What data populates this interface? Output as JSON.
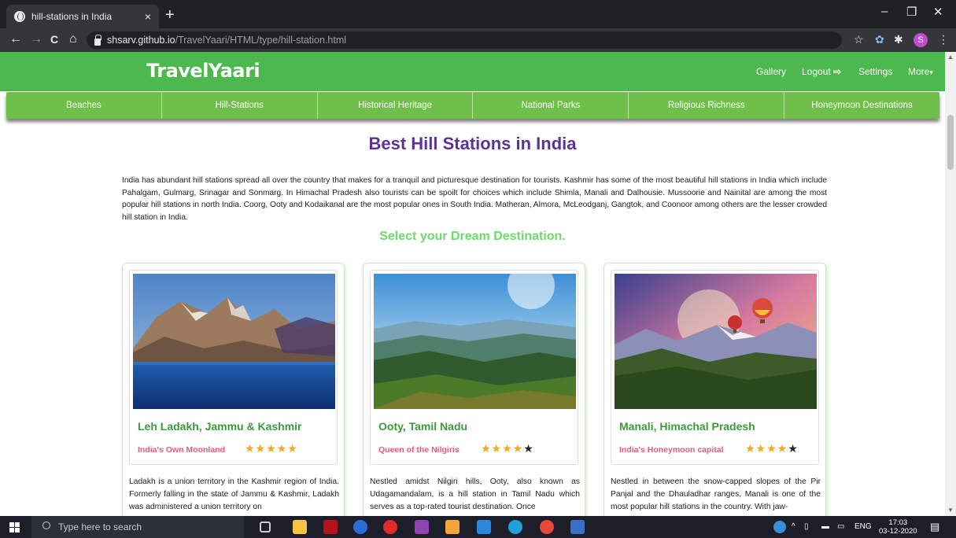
{
  "browser": {
    "tab_title": "hill-stations in India",
    "tab_close": "×",
    "new_tab": "+",
    "url_host": "shsarv.github.io",
    "url_path": "/TravelYaari/HTML/type/hill-station.html",
    "profile_initial": "S",
    "window_controls": {
      "minimize": "–",
      "restore": "❐",
      "close": "✕"
    },
    "nav": {
      "back": "←",
      "forward": "→",
      "reload": "C",
      "home": "⌂"
    },
    "extensions": {
      "star": "☆",
      "puzzle": "✱",
      "menu": "⋮",
      "ext1": "✿"
    }
  },
  "site": {
    "brand": "TravelYaari",
    "nav": {
      "gallery": "Gallery",
      "logout": "Logout",
      "logout_icon": "⇨",
      "settings": "Settings",
      "more": "More",
      "more_caret": "▾"
    },
    "categories": [
      "Beaches",
      "Hill-Stations",
      "Historical Heritage",
      "National Parks",
      "Religious Richness",
      "Honeymoon Destinations"
    ],
    "heading": "Best Hill Stations in India",
    "intro": "India has abundant hill stations spread all over the country that makes for a tranquil and picturesque destination for tourists. Kashmir has some of the most beautiful hill stations in India which include Pahalgam, Gulmarg, Srinagar and Sonmarg. In Himachal Pradesh also tourists can be spoilt for choices which include Shimla, Manali and Dalhousie. Mussoorie and Nainital are among the most popular hill stations in north India. Coorg, Ooty and Kodaikanal are the most popular ones in South India. Matheran, Almora, McLeodganj, Gangtok, and Coonoor among others are the lesser crowded hill station in India.",
    "subheading": "Select your Dream Destination.",
    "cards": [
      {
        "place": "Leh Ladakh, Jammu & Kashmir",
        "tagline": "India's Own Moonland",
        "rating": 5,
        "stars": "★★★★★",
        "stars_off": "",
        "description": "Ladakh is a union territory in the Kashmir region of India. Formerly falling in the state of Jammu & Kashmir, Ladakh was administered a union territory on"
      },
      {
        "place": "Ooty, Tamil Nadu",
        "tagline": "Queen of the Nilgiris",
        "rating": 4,
        "stars": "★★★★",
        "stars_off": "★",
        "description": "Nestled amidst Nilgiri hills, Ooty, also known as Udagamandalam, is a hill station in Tamil Nadu which serves as a top-rated tourist destination. Once"
      },
      {
        "place": "Manali, Himachal Pradesh",
        "tagline": "India's Honeymoon capital",
        "rating": 4,
        "stars": "★★★★",
        "stars_off": "★",
        "description": "Nestled in between the snow-capped slopes of the Pir Panjal and the Dhauladhar ranges, Manali is one of the most popular hill stations in the country. With jaw-"
      }
    ]
  },
  "taskbar": {
    "search_placeholder": "Type here to search",
    "tray_arrow": "^",
    "language": "ENG",
    "time": "17:03",
    "date": "03-12-2020"
  },
  "colors": {
    "nav_green": "#4cb84e",
    "heading_purple": "#5e3196",
    "subheading_green": "#6cdb6c",
    "tagline_pink": "#e45b7a",
    "star_orange": "#f5a623"
  }
}
